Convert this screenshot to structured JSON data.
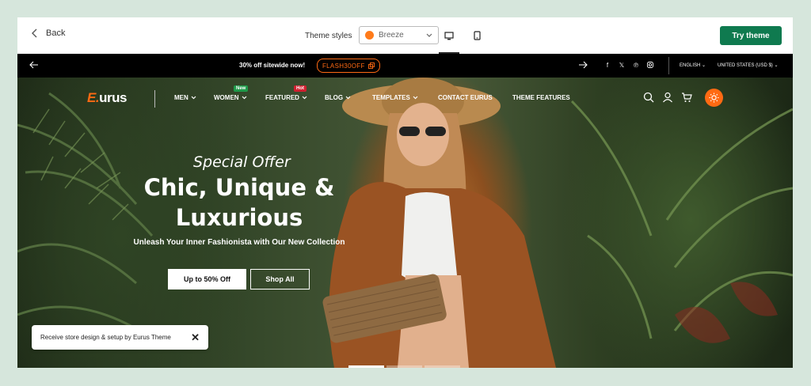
{
  "editor": {
    "back_label": "Back",
    "theme_styles_label": "Theme styles",
    "style_select": {
      "value": "Breeze",
      "swatch_color": "#ff7b1a"
    },
    "try_button": "Try theme",
    "accent_color": "#0f7a4f"
  },
  "announcement": {
    "promo_text": "30% off sitewide now!",
    "code": "FLASH30OFF",
    "social_icons": [
      "facebook-icon",
      "x-icon",
      "pinterest-icon",
      "instagram-icon"
    ],
    "language": "ENGLISH",
    "currency": "UNITED STATES (USD $)"
  },
  "header": {
    "logo_mark": "E.",
    "logo_text": "urus",
    "nav": [
      {
        "label": "MEN",
        "badge": ""
      },
      {
        "label": "WOMEN",
        "badge": "New"
      },
      {
        "label": "FEATURED",
        "badge": "Hot"
      },
      {
        "label": "BLOG",
        "badge": ""
      },
      {
        "label": "TEMPLATES",
        "badge": ""
      },
      {
        "label": "CONTACT EURUS",
        "badge": ""
      },
      {
        "label": "THEME FEATURES",
        "badge": ""
      }
    ],
    "brand_color": "#ff6a13"
  },
  "hero": {
    "kicker": "Special Offer",
    "headline_line1": "Chic, Unique &",
    "headline_line2": "Luxurious",
    "subline": "Unleash Your Inner Fashionista with Our New Collection",
    "primary_button": "Up to 50% Off",
    "secondary_button": "Shop All"
  },
  "toast": {
    "text": "Receive store design & setup by Eurus Theme"
  }
}
